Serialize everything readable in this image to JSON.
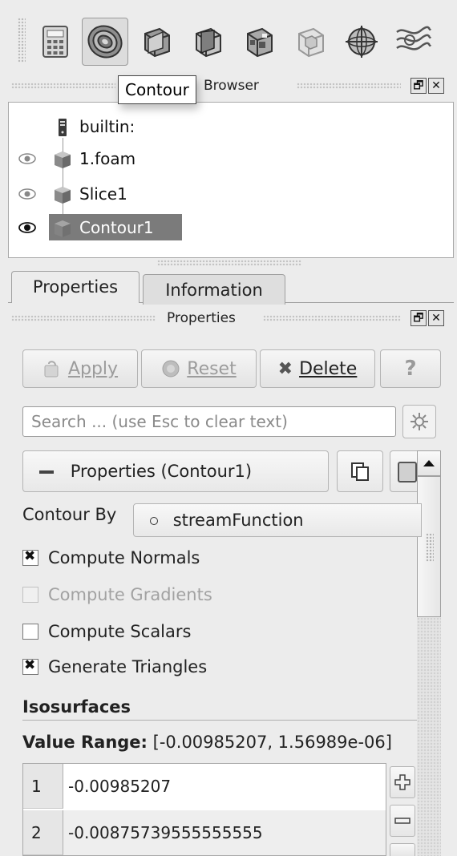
{
  "toolbar": {
    "tools": [
      {
        "icon": "calculator-icon"
      },
      {
        "icon": "contour-icon",
        "active": true
      },
      {
        "icon": "clip-icon"
      },
      {
        "icon": "slice-icon"
      },
      {
        "icon": "threshold-icon"
      },
      {
        "icon": "extract-subset-icon"
      },
      {
        "icon": "glyph-icon"
      },
      {
        "icon": "stream-tracer-icon"
      }
    ]
  },
  "tooltip": "Contour",
  "pipeline_browser": {
    "title": "Pipeline Browser",
    "title_visible": "Browser",
    "items": [
      {
        "label": "builtin:"
      },
      {
        "label": "1.foam",
        "visible": true
      },
      {
        "label": "Slice1",
        "visible": true
      },
      {
        "label": "Contour1",
        "visible": true,
        "selected": true
      }
    ]
  },
  "tabs": [
    {
      "label": "Properties",
      "active": true
    },
    {
      "label": "Information",
      "active": false
    }
  ],
  "properties_panel": {
    "title": "Properties",
    "buttons": {
      "apply": "Apply",
      "reset": "Reset",
      "delete": "Delete",
      "help": "?"
    },
    "search_placeholder": "Search ... (use Esc to clear text)",
    "section_label": "Properties (Contour1)",
    "contour_by_label": "Contour By",
    "contour_by_value": "streamFunction",
    "checkboxes": [
      {
        "label": "Compute Normals",
        "checked": true,
        "enabled": true
      },
      {
        "label": "Compute Gradients",
        "checked": false,
        "enabled": false
      },
      {
        "label": "Compute Scalars",
        "checked": false,
        "enabled": true
      },
      {
        "label": "Generate Triangles",
        "checked": true,
        "enabled": true
      }
    ],
    "isosurfaces_header": "Isosurfaces",
    "value_range_label": "Value Range:",
    "value_range_value": "[-0.00985207, 1.56989e-06]",
    "isosurface_values": [
      {
        "index": "1",
        "value": "-0.00985207"
      },
      {
        "index": "2",
        "value": "-0.00875739555555555"
      }
    ]
  }
}
